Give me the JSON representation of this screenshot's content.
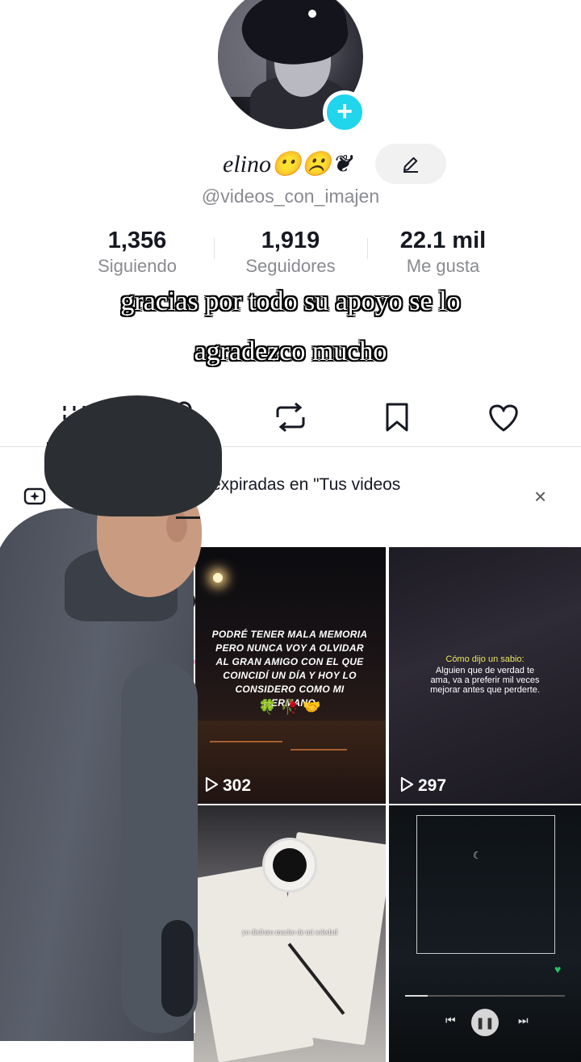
{
  "profile": {
    "display_name": "elino😶☹️❦",
    "chevron": "⌄",
    "username": "@videos_con_imajen",
    "add_symbol": "+"
  },
  "stats": [
    {
      "value": "1,356",
      "label": "Siguiendo"
    },
    {
      "value": "1,919",
      "label": "Seguidores"
    },
    {
      "value": "22.1 mil",
      "label": "Me gusta"
    }
  ],
  "caption": {
    "line1": "gracias por todo su apoyo se lo",
    "line2": "agradezco mucho"
  },
  "tabs": [
    "videos-grid-icon",
    "lock-icon",
    "repost-icon",
    "bookmark-icon",
    "heart-icon"
  ],
  "banner": {
    "text": "expiradas en \"Tus videos",
    "close": "×"
  },
  "videos": [
    {
      "views": "302",
      "text": "PODRÉ TENER MALA MEMORIA PERO NUNCA VOY A OLVIDAR AL GRAN AMIGO CON EL QUE COINCIDÍ UN DÍA Y HOY LO CONSIDERO COMO MI HERMANO",
      "emojis": "🍀 🥀 🤝"
    },
    {
      "views": "297",
      "title": "Cómo dijo un sabio:",
      "text": "Alguien que de verdad te ama, va a preferir mil veces mejorar antes que perderte."
    },
    {
      "views": "",
      "text": "yo disfruto mucho de mi soledad"
    },
    {
      "views": "",
      "text": ""
    }
  ],
  "colors": {
    "accent": "#20d5ec",
    "text_primary": "#161823",
    "text_secondary": "#8a8b91"
  }
}
